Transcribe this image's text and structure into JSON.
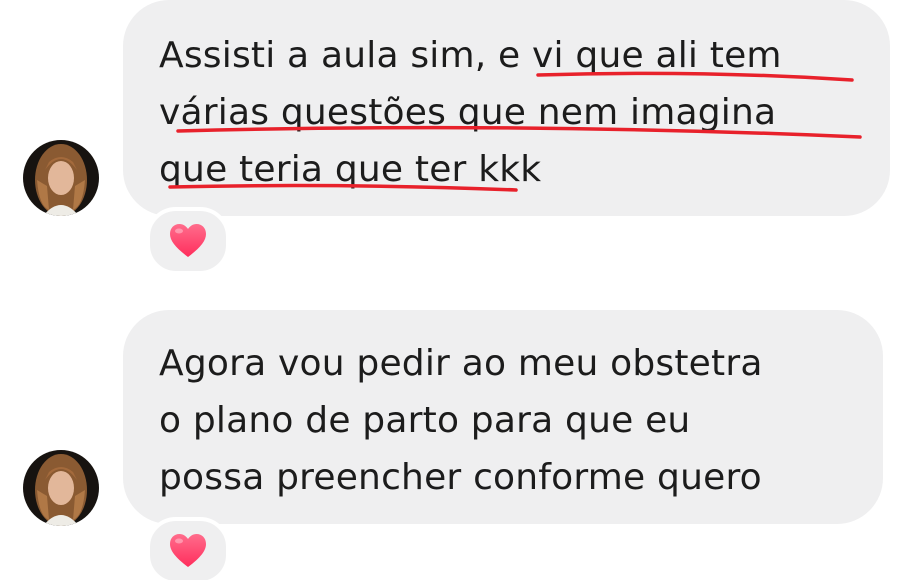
{
  "messages": [
    {
      "lines": [
        "Assisti a aula sim, e vi que ali tem",
        "várias questões que nem imagina",
        "que teria que ter kkk"
      ],
      "reaction": "heart"
    },
    {
      "lines": [
        "Agora vou pedir ao meu obstetra",
        "o plano de parto para que eu",
        "possa preencher conforme quero"
      ],
      "reaction": "heart"
    }
  ],
  "colors": {
    "bubble": "#efeff0",
    "text": "#1c1c1c",
    "underline": "#e8212b",
    "heart": "#ff3c6e"
  },
  "icons": [
    "heart-icon",
    "avatar"
  ]
}
